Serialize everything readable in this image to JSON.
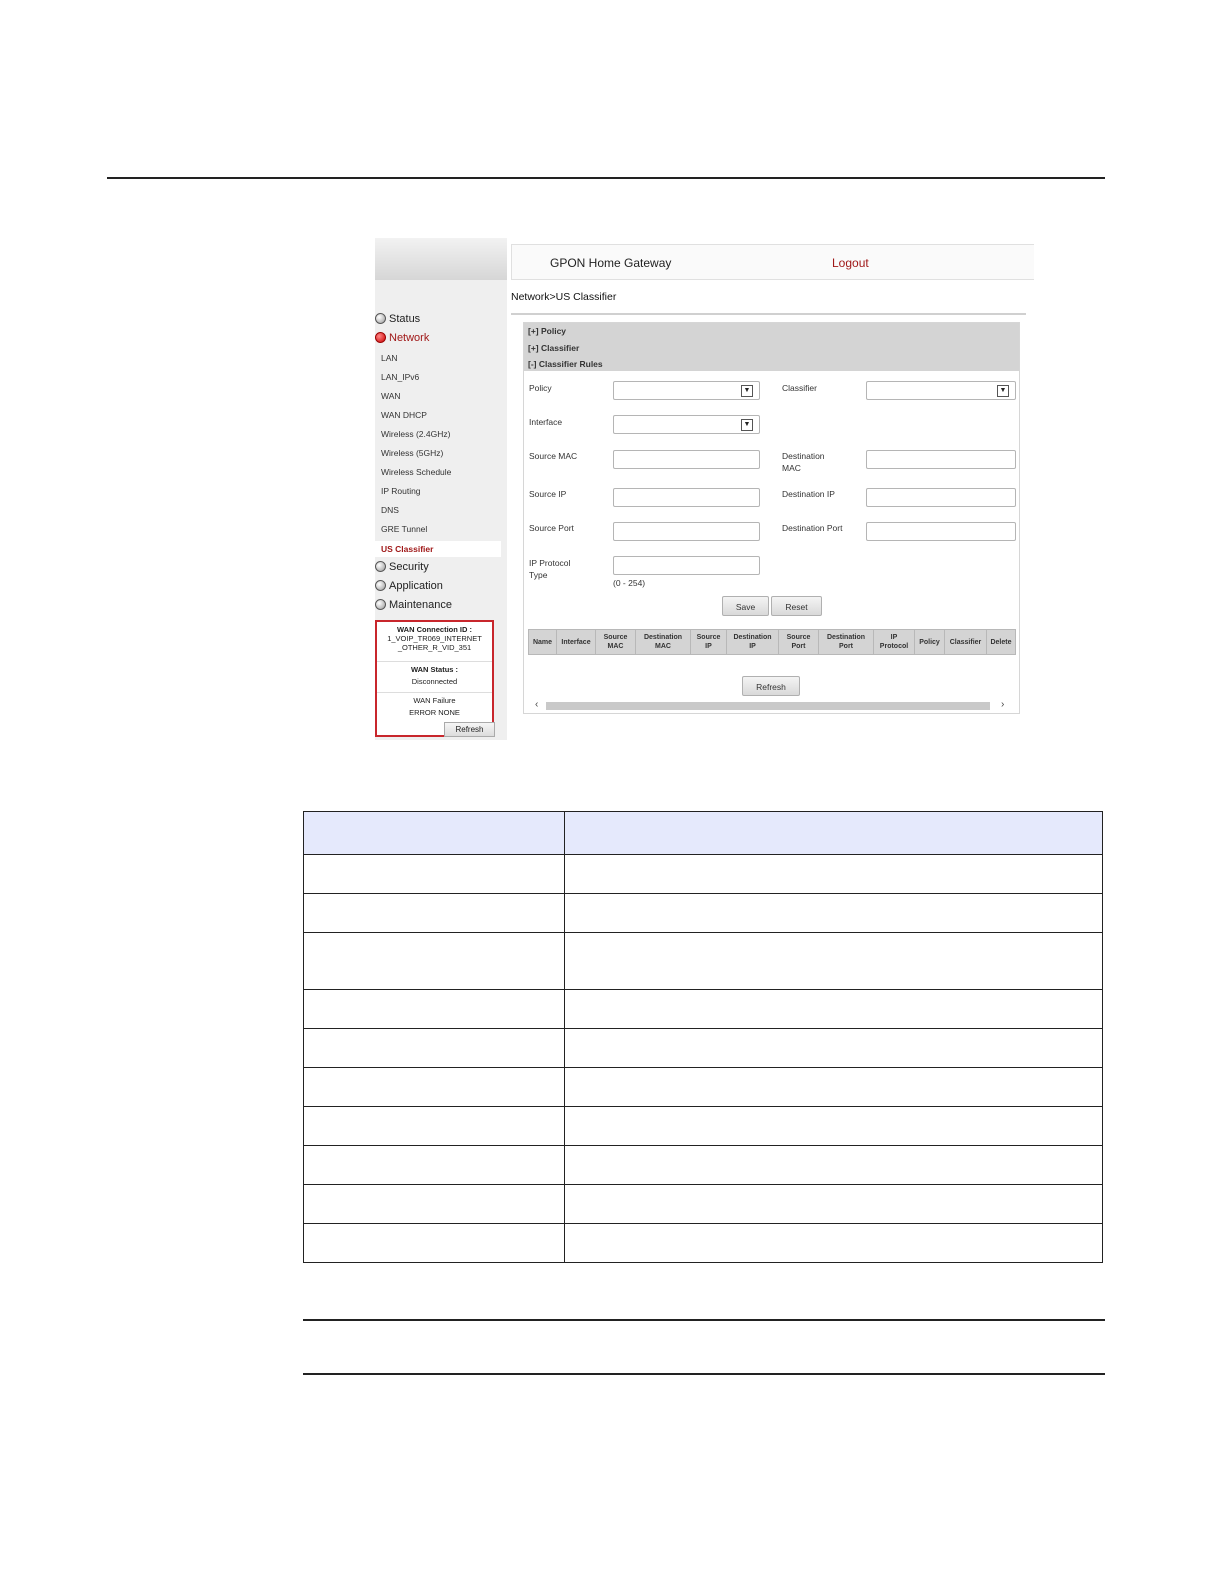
{
  "header": {
    "title": "GPON Home Gateway",
    "logout": "Logout"
  },
  "breadcrumb": "Network>US Classifier",
  "sidebar": {
    "top_items": [
      {
        "label": "Status"
      },
      {
        "label": "Network"
      },
      {
        "label": "Security"
      },
      {
        "label": "Application"
      },
      {
        "label": "Maintenance"
      }
    ],
    "network_sub": [
      "LAN",
      "LAN_IPv6",
      "WAN",
      "WAN DHCP",
      "Wireless (2.4GHz)",
      "Wireless (5GHz)",
      "Wireless Schedule",
      "IP Routing",
      "DNS",
      "GRE Tunnel",
      "US Classifier"
    ]
  },
  "wan_status": {
    "connection_id_label": "WAN Connection ID :",
    "connection_id_line1": "1_VOIP_TR069_INTERNET",
    "connection_id_line2": "_OTHER_R_VID_351",
    "status_label": "WAN Status :",
    "status_value": "Disconnected",
    "failure_label": "WAN Failure",
    "failure_value": "ERROR NONE",
    "refresh": "Refresh"
  },
  "sections": [
    "[+] Policy",
    "[+] Classifier",
    "[-] Classifier Rules"
  ],
  "form": {
    "policy": "Policy",
    "classifier": "Classifier",
    "interface": "Interface",
    "source_mac": "Source MAC",
    "destination_mac_1": "Destination",
    "destination_mac_2": "MAC",
    "source_ip": "Source IP",
    "destination_ip": "Destination IP",
    "source_port": "Source Port",
    "destination_port": "Destination Port",
    "ip_protocol_1": "IP Protocol",
    "ip_protocol_2": "Type",
    "ip_protocol_hint": "(0 - 254)",
    "save": "Save",
    "reset": "Reset"
  },
  "rules_table": {
    "headers": [
      [
        "Name"
      ],
      [
        "Interface"
      ],
      [
        "Source",
        "MAC"
      ],
      [
        "Destination",
        "MAC"
      ],
      [
        "Source",
        "IP"
      ],
      [
        "Destination",
        "IP"
      ],
      [
        "Source",
        "Port"
      ],
      [
        "Destination",
        "Port"
      ],
      [
        "IP",
        "Protocol"
      ],
      [
        "Policy"
      ],
      [
        "Classifier"
      ],
      [
        "Delete"
      ]
    ],
    "refresh": "Refresh"
  }
}
